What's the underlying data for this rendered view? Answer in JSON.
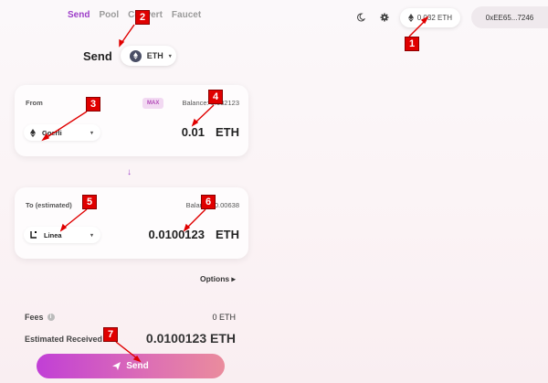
{
  "nav": {
    "items": [
      "Send",
      "Pool",
      "Convert",
      "Faucet"
    ]
  },
  "header": {
    "balance": "0.032 ETH",
    "address": "0xEE65...7246"
  },
  "send": {
    "title": "Send",
    "token": "ETH"
  },
  "from_card": {
    "label": "From",
    "max": "MAX",
    "balance": "Balance: 0.032123",
    "chain": "Goerli",
    "amount": "0.01",
    "unit": "ETH"
  },
  "to_card": {
    "label": "To (estimated)",
    "balance": "Balance: 0.00638",
    "chain": "Linea",
    "amount": "0.0100123",
    "unit": "ETH"
  },
  "options": "Options ▸",
  "fees": {
    "label": "Fees",
    "value": "0 ETH"
  },
  "estimated": {
    "label": "Estimated Received",
    "value": "0.0100123 ETH"
  },
  "button": {
    "label": "Send"
  },
  "markers": [
    "1",
    "2",
    "3",
    "4",
    "5",
    "6",
    "7"
  ],
  "colors": {
    "accent": "#9d3ec9",
    "marker": "#e00000"
  }
}
